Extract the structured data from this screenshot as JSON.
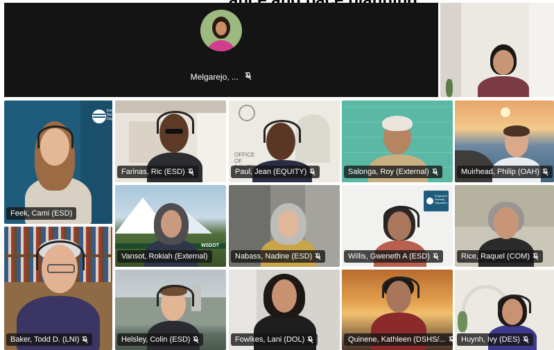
{
  "banner": {
    "text": "ance and pace planning"
  },
  "speaker": {
    "name": "Melgarejo, ..."
  },
  "tiles": [
    {
      "name": "Feek, Cami (ESD)"
    },
    {
      "name": "Farinas, Ric (ESD)"
    },
    {
      "name": "Paul, Jean (EQUITY)"
    },
    {
      "name": "Salonga, Roy (External)"
    },
    {
      "name": "Muirhead, Philip (OAH)"
    },
    {
      "name": "Vansot, Rokiah (External)"
    },
    {
      "name": "Nabass, Nadine (ESD)"
    },
    {
      "name": "Willis, Gweneth A (ESD)"
    },
    {
      "name": "Rice, Raquel (COM)"
    },
    {
      "name": "Baker, Todd D. (LNI)"
    },
    {
      "name": "Helsley, Colin (ESD)"
    },
    {
      "name": "Fowlkes, Lani (DOL)"
    },
    {
      "name": "Quinene, Kathleen (DSHS/..."
    },
    {
      "name": "Huynh, Ivy (DES)"
    }
  ],
  "signage": {
    "esd_logo": "Employment Security Department",
    "equity_office": "OFFICE OF EQUITY",
    "wsdot": "WSDOT"
  }
}
